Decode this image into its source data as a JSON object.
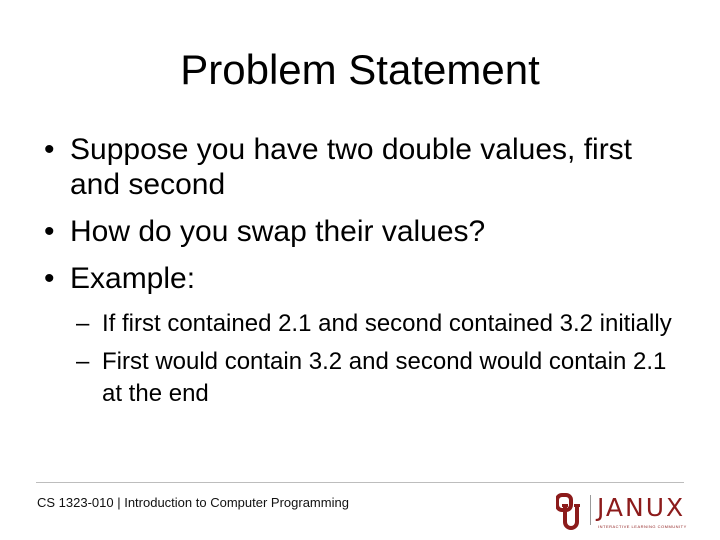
{
  "slide": {
    "title": "Problem Statement",
    "bullets": [
      "Suppose you have two double values, first and second",
      "How do you swap their values?",
      "Example:"
    ],
    "sub_bullets": [
      "If first contained 2.1 and second contained 3.2 initially",
      "First would contain 3.2 and second would contain 2.1 at the end"
    ],
    "bullet_glyph": "•",
    "dash_glyph": "–"
  },
  "footer": {
    "course": "CS 1323-010 | Introduction to Computer Programming",
    "brand": "JANUX",
    "tagline": "INTERACTIVE LEARNING COMMUNITY",
    "logo_icon": "ou-interlocking-logo-icon",
    "brand_color": "#8c1b1b"
  }
}
